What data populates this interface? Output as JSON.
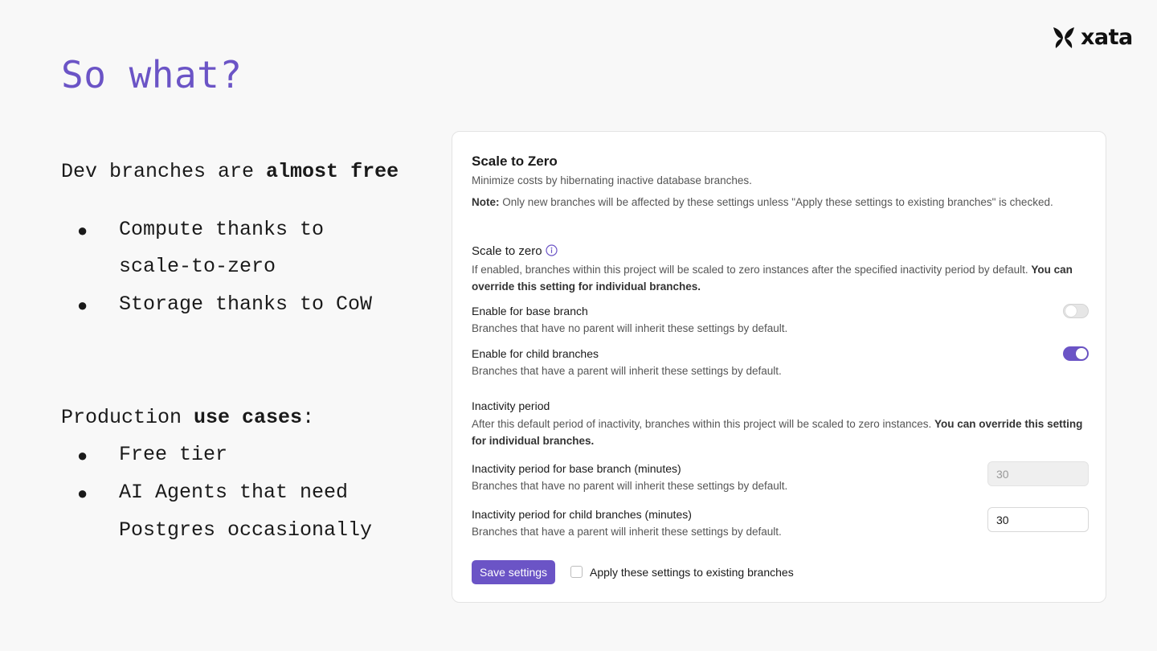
{
  "slide": {
    "title": "So what?",
    "logo_text": "xata",
    "dev": {
      "prefix": "Dev branches are ",
      "bold": "almost free",
      "bullets": [
        {
          "lines": [
            "Compute thanks to",
            "scale-to-zero"
          ]
        },
        {
          "lines": [
            "Storage thanks to CoW"
          ]
        }
      ]
    },
    "prod": {
      "prefix": "Production ",
      "bold": "use cases",
      "suffix": ":",
      "bullets": [
        {
          "lines": [
            "Free tier"
          ]
        },
        {
          "lines": [
            "AI Agents that need",
            "Postgres occasionally"
          ]
        }
      ]
    },
    "bullet_glyph": "●"
  },
  "settings": {
    "title": "Scale to Zero",
    "subtitle": "Minimize costs by hibernating inactive database branches.",
    "note_label": "Note:",
    "note_text": " Only new branches will be affected by these settings unless \"Apply these settings to existing branches\" is checked.",
    "scale": {
      "heading": "Scale to zero",
      "desc": "If enabled, branches within this project will be scaled to zero instances after the specified inactivity period by default. ",
      "desc_bold": "You can override this setting for individual branches.",
      "base": {
        "label": "Enable for base branch",
        "desc": "Branches that have no parent will inherit these settings by default.",
        "enabled": false
      },
      "child": {
        "label": "Enable for child branches",
        "desc": "Branches that have a parent will inherit these settings by default.",
        "enabled": true
      }
    },
    "inactivity": {
      "heading": "Inactivity period",
      "desc": "After this default period of inactivity, branches within this project will be scaled to zero instances. ",
      "desc_bold": "You can override this setting for individual branches.",
      "base": {
        "label": "Inactivity period for base branch (minutes)",
        "desc": "Branches that have no parent will inherit these settings by default.",
        "value": "30",
        "disabled": true
      },
      "child": {
        "label": "Inactivity period for child branches (minutes)",
        "desc": "Branches that have a parent will inherit these settings by default.",
        "value": "30",
        "disabled": false
      }
    },
    "save_label": "Save settings",
    "apply_label": "Apply these settings to existing branches",
    "apply_checked": false
  },
  "colors": {
    "accent": "#6b54c6",
    "background": "#f8f8f8",
    "card": "#ffffff"
  }
}
